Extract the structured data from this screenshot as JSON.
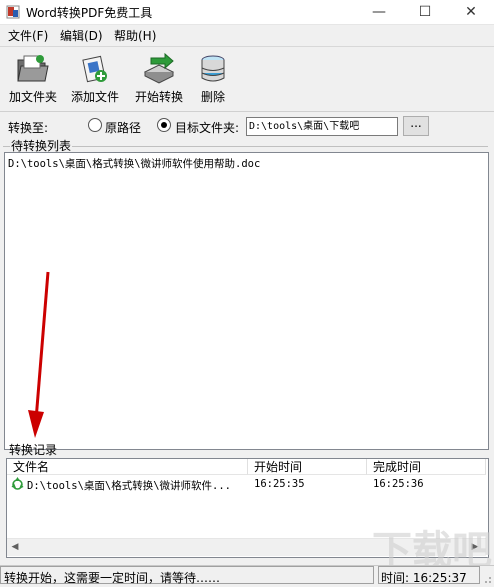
{
  "window": {
    "title": "Word转换PDF免费工具",
    "min_glyph": "—",
    "max_glyph": "☐",
    "close_glyph": "✕"
  },
  "menu": {
    "file": "文件(F)",
    "edit": "编辑(D)",
    "help": "帮助(H)"
  },
  "toolbar": {
    "add_folder": "加文件夹",
    "add_file": "添加文件",
    "start": "开始转换",
    "delete": "删除"
  },
  "convert_to": {
    "label": "转换至:",
    "option_original": "原路径",
    "option_target": "目标文件夹:",
    "selected": "目标文件夹:",
    "path_value": "D:\\tools\\桌面\\下载吧",
    "browse_label": "..."
  },
  "pending": {
    "legend": "待转换列表",
    "items": [
      "D:\\tools\\桌面\\格式转换\\微讲师软件使用帮助.doc"
    ]
  },
  "records": {
    "label": "转换记录",
    "columns": [
      "文件名",
      "开始时间",
      "完成时间"
    ],
    "rows": [
      {
        "name": "D:\\tools\\桌面\\格式转换\\微讲师软件...",
        "start": "16:25:35",
        "end": "16:25:36"
      }
    ]
  },
  "status": {
    "message": "转换开始，这需要一定时间，请等待……",
    "time": "时间: 16:25:37"
  },
  "watermark": "下载吧",
  "colors": {
    "arrow": "#cc0000",
    "accent_green": "#2e9b3a"
  }
}
